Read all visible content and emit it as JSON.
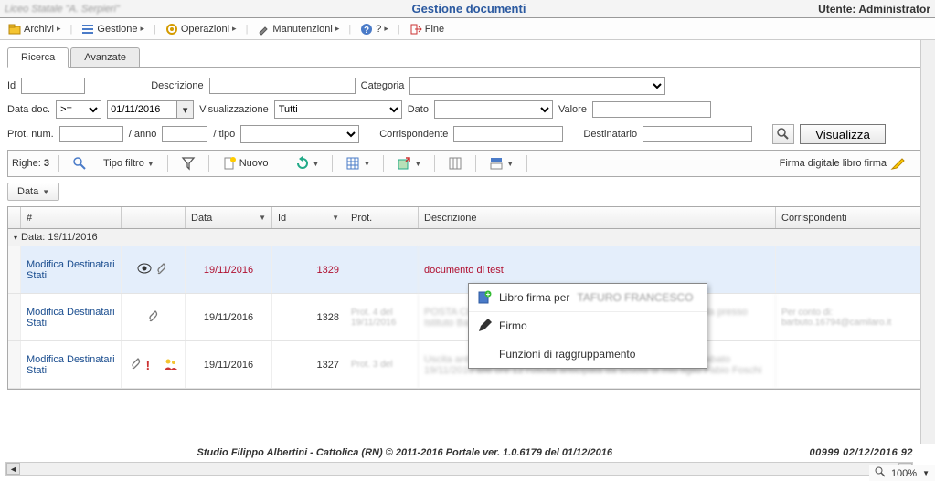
{
  "header": {
    "left_blur": "Liceo Statale \"A. Serpieri\"",
    "title": "Gestione documenti",
    "user_label": "Utente:",
    "user_name": "Administrator"
  },
  "menu": {
    "archivi": "Archivi",
    "gestione": "Gestione",
    "operazioni": "Operazioni",
    "manutenzioni": "Manutenzioni",
    "help": "?",
    "fine": "Fine"
  },
  "tabs": {
    "ricerca": "Ricerca",
    "avanzate": "Avanzate"
  },
  "form": {
    "id": "Id",
    "descrizione": "Descrizione",
    "categoria": "Categoria",
    "data_doc": "Data doc.",
    "op": ">=",
    "date_val": "01/11/2016",
    "visualizzazione": "Visualizzazione",
    "vis_val": "Tutti",
    "dato": "Dato",
    "valore": "Valore",
    "prot_num": "Prot. num.",
    "anno": "/ anno",
    "tipo": "/ tipo",
    "corrispondente": "Corrispondente",
    "destinatario": "Destinatario",
    "visualizza": "Visualizza"
  },
  "toolbar": {
    "righe": "Righe:",
    "righe_n": "3",
    "tipo_filtro": "Tipo filtro",
    "nuovo": "Nuovo",
    "firma_digitale": "Firma digitale libro firma"
  },
  "data_btn": "Data",
  "grid": {
    "hash": "#",
    "data": "Data",
    "id": "Id",
    "prot": "Prot.",
    "descrizione": "Descrizione",
    "corrispondenti": "Corrispondenti",
    "group_label": "Data: 19/11/2016",
    "modifica_link": "Modifica Destinatari Stati",
    "rows": [
      {
        "data": "19/11/2016",
        "id": "1329",
        "prot": "",
        "desc": "documento di test",
        "desc_red": true,
        "corr": ""
      },
      {
        "data": "19/11/2016",
        "id": "1328",
        "prot": "Prot. 4 del 19/11/2016",
        "desc": "POSTA CERTIFICATA: certificato. Il giorno Domanda di matricola presso Istituto Barbuto 16794@...",
        "corr": "Per conto di: barbuto.16794@camilaro.it"
      },
      {
        "data": "19/11/2016",
        "id": "1327",
        "prot": "Prot. 3 del",
        "desc": "Uscita anticipata Fabio Foschi Con la presente autorizzo oggi sabato 19/11/2016 alle ore 12 l'uscita anticipata da scuola di mio figlio Fabio Foschi",
        "corr": ""
      }
    ]
  },
  "context_menu": {
    "libro_firma": "Libro firma per",
    "libro_firma_user": "TAFURO FRANCESCO",
    "firmo": "Firmo",
    "funzioni": "Funzioni di raggruppamento"
  },
  "footer": {
    "center": "Studio Filippo Albertini - Cattolica (RN) © 2011-2016     Portale ver. 1.0.6179 del 01/12/2016",
    "right": "00999  02/12/2016  92"
  },
  "status": {
    "zoom": "100%"
  }
}
